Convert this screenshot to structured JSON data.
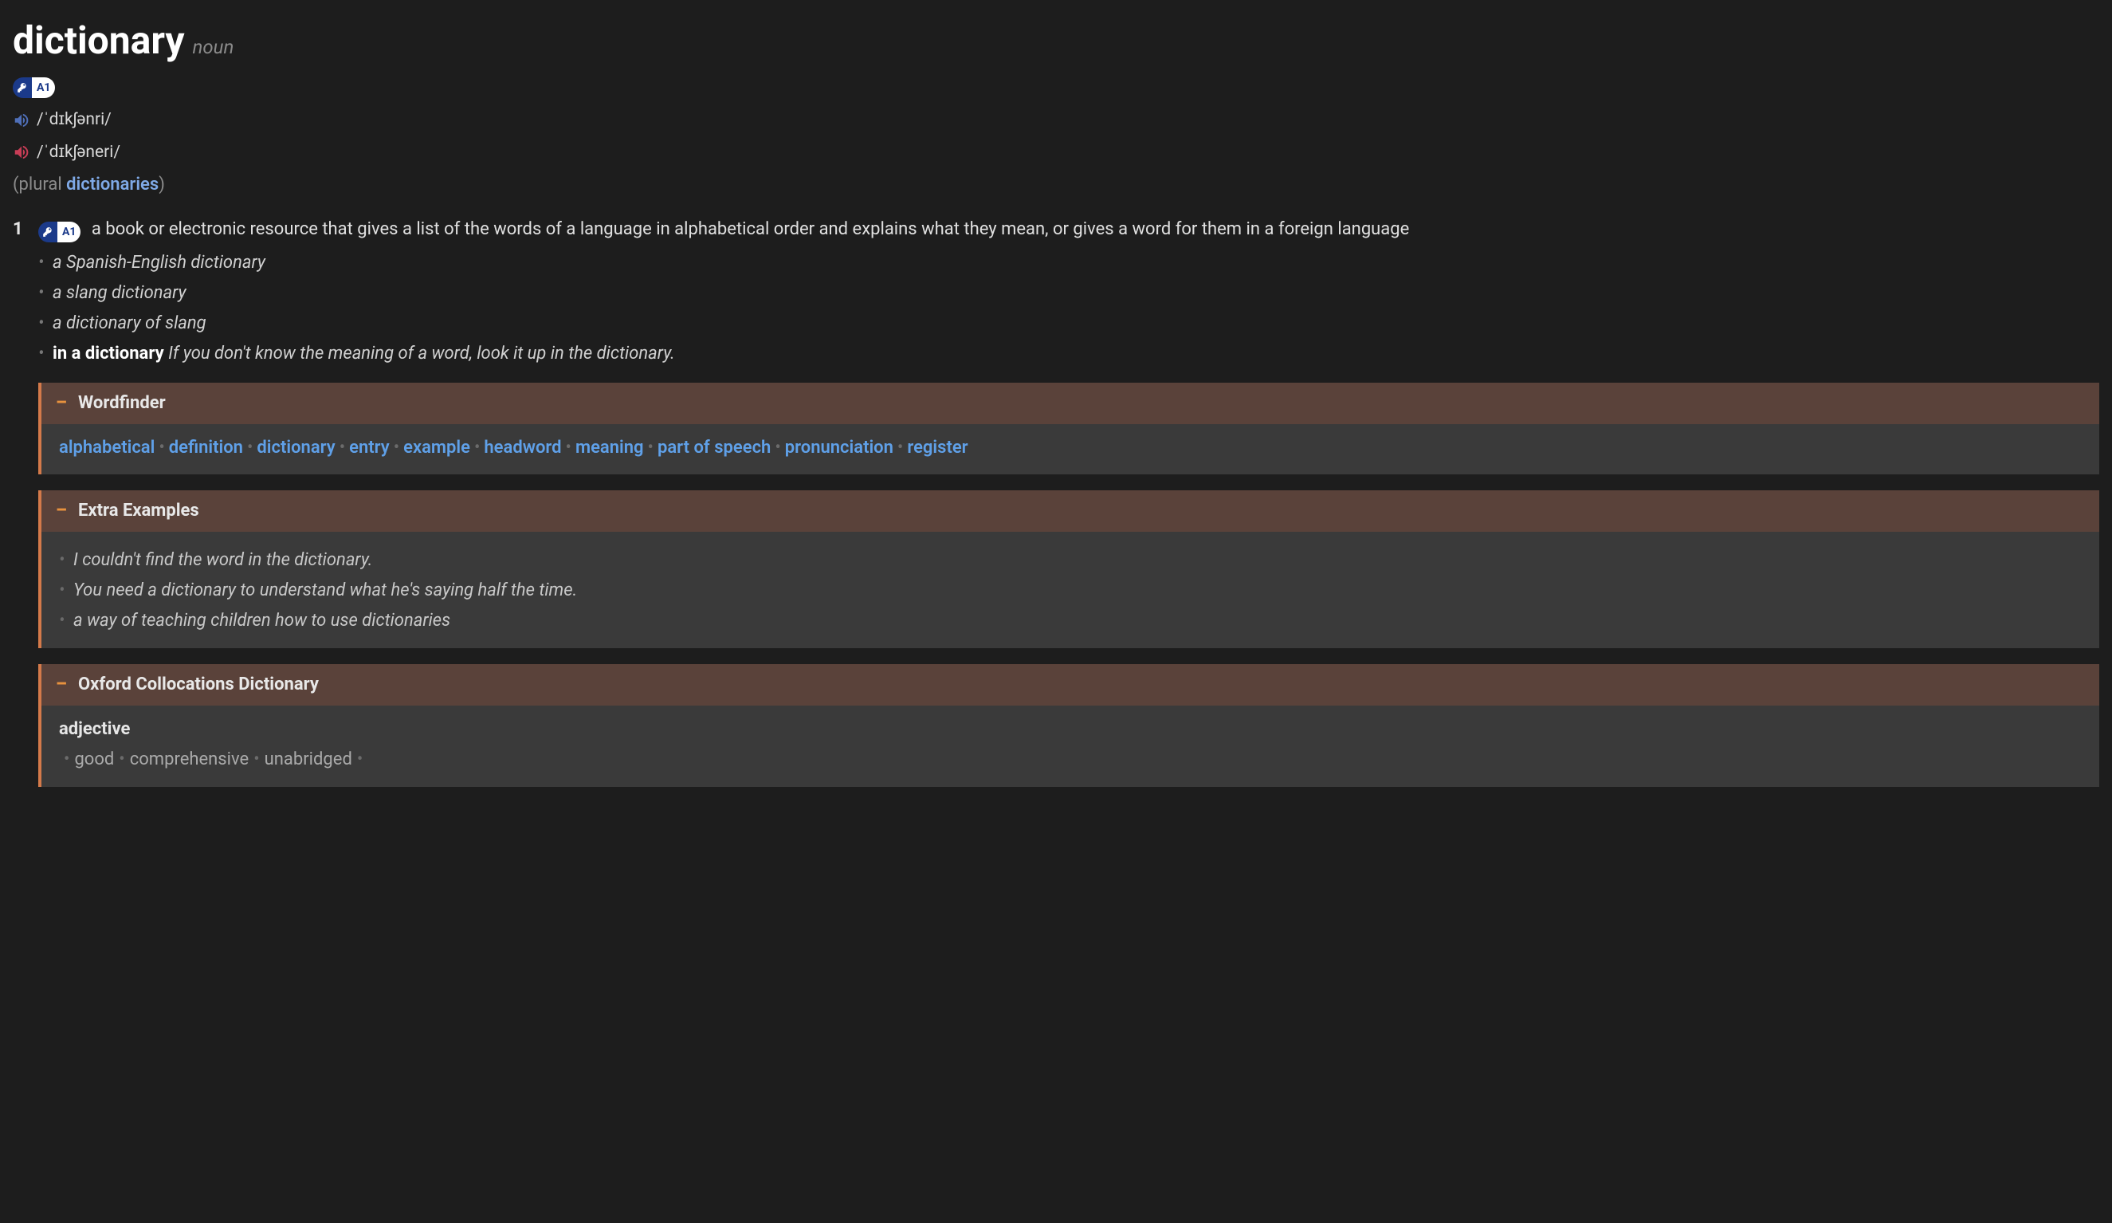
{
  "headword": "dictionary",
  "pos": "noun",
  "cefr": "A1",
  "pron": {
    "uk": "/ˈdɪkʃənri/",
    "us": "/ˈdɪkʃəneri/"
  },
  "inflection": {
    "prefix": "(plural ",
    "form": "dictionaries",
    "suffix": ")"
  },
  "senses": [
    {
      "num": "1",
      "cefr": "A1",
      "def": "a book or electronic resource that gives a list of the words of a language in alphabetical order and explains what they mean, or gives a word for them in a foreign language",
      "examples": [
        {
          "cf": "",
          "x": "a Spanish-English dictionary"
        },
        {
          "cf": "",
          "x": "a slang dictionary"
        },
        {
          "cf": "",
          "x": "a dictionary of slang"
        },
        {
          "cf": "in a dictionary",
          "x": "If you don't know the meaning of a word, look it up in the dictionary."
        }
      ],
      "panels": {
        "wordfinder": {
          "title": "Wordfinder",
          "links": [
            "alphabetical",
            "definition",
            "dictionary",
            "entry",
            "example",
            "headword",
            "meaning",
            "part of speech",
            "pronunciation",
            "register"
          ]
        },
        "extra_examples": {
          "title": "Extra Examples",
          "items": [
            "I couldn't find the word in the dictionary.",
            "You need a dictionary to understand what he's saying half the time.",
            "a way of teaching children how to use dictionaries"
          ]
        },
        "collocations": {
          "title": "Oxford Collocations Dictionary",
          "groups": [
            {
              "label": "adjective",
              "items": [
                "good",
                "comprehensive",
                "unabridged"
              ]
            }
          ]
        }
      }
    }
  ]
}
